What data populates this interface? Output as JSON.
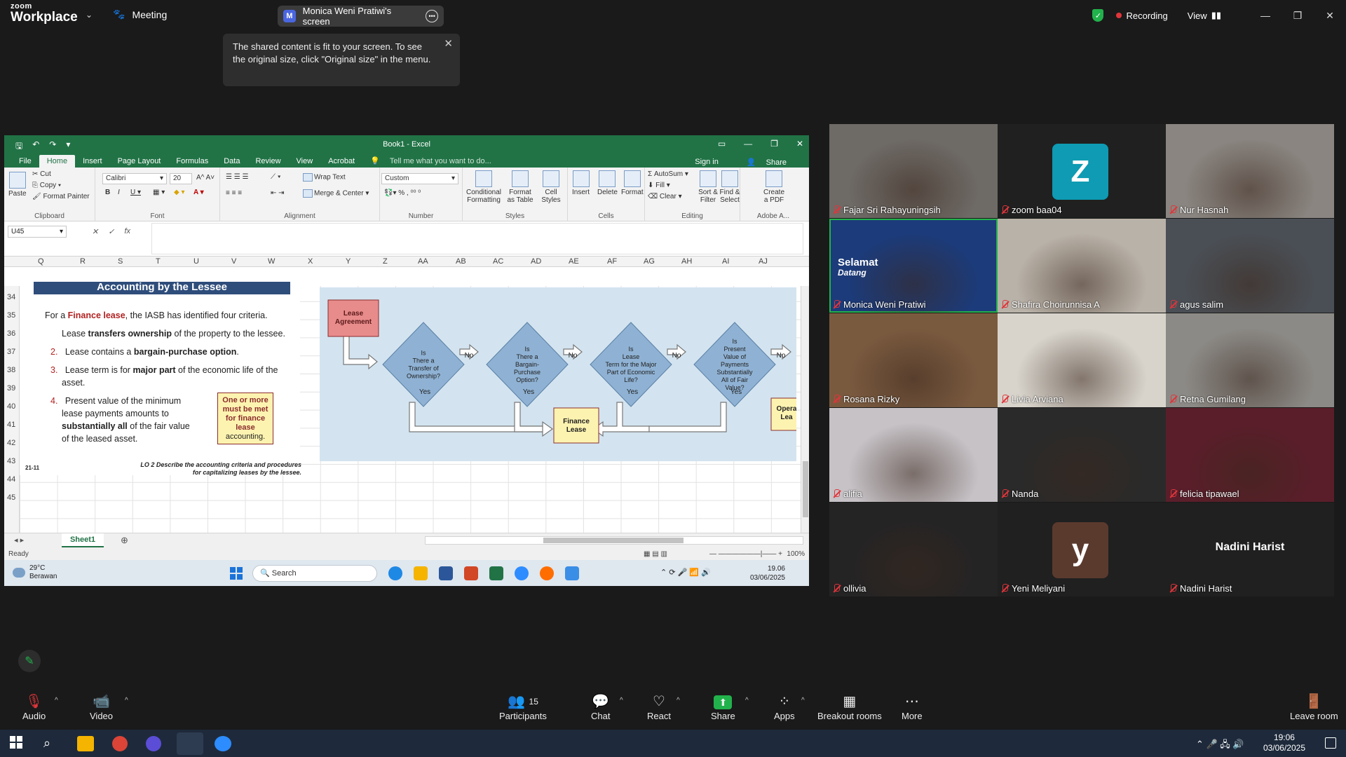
{
  "zoom": {
    "logo_line1": "zoom",
    "logo_line2": "Workplace",
    "meeting_label": "Meeting",
    "share_initial": "M",
    "share_label": "Monica Weni Pratiwi's screen",
    "recording_label": "Recording",
    "view_label": "View",
    "tooltip_text": "The shared content is fit to your screen. To see the original size, click \"Original size\" in the menu."
  },
  "excel": {
    "window_title": "Book1 - Excel",
    "tabs": [
      "File",
      "Home",
      "Insert",
      "Page Layout",
      "Formulas",
      "Data",
      "Review",
      "View",
      "Acrobat"
    ],
    "tell_me": "Tell me what you want to do...",
    "sign_in": "Sign in",
    "share": "Share",
    "clipboard": {
      "paste": "Paste",
      "cut": "Cut",
      "copy": "Copy",
      "format_painter": "Format Painter",
      "label": "Clipboard"
    },
    "font": {
      "name": "Calibri",
      "size": "20",
      "label": "Font"
    },
    "alignment": {
      "wrap": "Wrap Text",
      "merge": "Merge & Center",
      "label": "Alignment"
    },
    "number": {
      "format": "Custom",
      "label": "Number"
    },
    "styles": {
      "conditional": "Conditional Formatting",
      "format_table": "Format as Table",
      "cell_styles": "Cell Styles",
      "label": "Styles"
    },
    "cells": {
      "insert": "Insert",
      "delete": "Delete",
      "format": "Format",
      "label": "Cells"
    },
    "editing": {
      "autosum": "AutoSum",
      "fill": "Fill",
      "clear": "Clear",
      "sort": "Sort & Filter",
      "find": "Find & Select",
      "label": "Editing"
    },
    "acrobat": {
      "create": "Create a PDF",
      "label": "Adobe A..."
    },
    "name_box": "U45",
    "columns": [
      "Q",
      "R",
      "S",
      "T",
      "U",
      "V",
      "W",
      "X",
      "Y",
      "Z",
      "AA",
      "AB",
      "AC",
      "AD",
      "AE",
      "AF",
      "AG",
      "AH",
      "AI",
      "AJ"
    ],
    "rows": [
      "34",
      "35",
      "36",
      "37",
      "38",
      "39",
      "40",
      "41",
      "42",
      "43",
      "44",
      "45"
    ],
    "sheet_tab": "Sheet1",
    "status": "Ready",
    "zoom_pct": "100%"
  },
  "slide": {
    "title": "Accounting by the Lessee",
    "intro_pre": "For a ",
    "intro_red": "Finance lease",
    "intro_post": ", the IASB has identified four criteria.",
    "c1_pre": "Lease ",
    "c1_bold": "transfers ownership",
    "c1_post": " of the property to the lessee.",
    "c2_num": "2.",
    "c2_pre": "Lease contains a ",
    "c2_bold": "bargain-purchase option",
    "c2_post": ".",
    "c3_num": "3.",
    "c3_pre": "Lease term is for ",
    "c3_bold": "major part",
    "c3_post": " of the economic life of the",
    "c3_line2": "asset.",
    "c4_num": "4.",
    "c4_line1": "Present value of the minimum",
    "c4_line2": "lease payments amounts to",
    "c4_bold": "substantially all",
    "c4_post": " of the fair value",
    "c4_line4": "of the leased asset.",
    "box_l1": "One or more",
    "box_l2": "must be met",
    "box_l3": "for finance",
    "box_l4": "lease",
    "box_l5": "accounting.",
    "lo_line1": "LO 2  Describe the accounting criteria and procedures",
    "lo_line2": "for capitalizing leases by the lessee.",
    "page_no": "21-11",
    "flow": {
      "lease_agreement": "Lease Agreement",
      "q1": [
        "Is",
        "There a",
        "Transfer of",
        "Ownership?"
      ],
      "q2": [
        "Is",
        "There a",
        "Bargain-",
        "Purchase",
        "Option?"
      ],
      "q3": [
        "Is",
        "Lease",
        "Term for the Major",
        "Part of Economic",
        "Life?"
      ],
      "q4": [
        "Is",
        "Present",
        "Value of",
        "Payments",
        "Substantially",
        "All of Fair",
        "Value?"
      ],
      "no": "No",
      "yes": "Yes",
      "finance_lease": [
        "Finance",
        "Lease"
      ],
      "operating": [
        "Opera",
        "Lea"
      ]
    }
  },
  "win_inner": {
    "temp": "29°C",
    "weather": "Berawan",
    "search": "Search",
    "time": "19.06",
    "date": "03/06/2025"
  },
  "gallery": [
    {
      "name": "Fajar Sri Rahayuningsih",
      "type": "video",
      "bg": "#6e6a66"
    },
    {
      "name": "zoom baa04",
      "type": "avatar",
      "letter": "Z",
      "color": "#0e9bb3"
    },
    {
      "name": "Nur Hasnah",
      "type": "video",
      "bg": "#8a8580"
    },
    {
      "name": "Monica Weni Pratiwi",
      "type": "video",
      "bg": "#1c3b7a",
      "active": true,
      "overlay1": "Selamat",
      "overlay2": "Datang"
    },
    {
      "name": "Shafira Choirunnisa A",
      "type": "video",
      "bg": "#b9b2a8"
    },
    {
      "name": "agus salim",
      "type": "video",
      "bg": "#4a4f55"
    },
    {
      "name": "Rosana Rizky",
      "type": "video",
      "bg": "#7a5a3f"
    },
    {
      "name": "Livia Arviana",
      "type": "video",
      "bg": "#d8d4cc"
    },
    {
      "name": "Retna Gumilang",
      "type": "video",
      "bg": "#8c8a86"
    },
    {
      "name": "alifia",
      "type": "video",
      "bg": "#c6c2c6"
    },
    {
      "name": "Nanda",
      "type": "video",
      "bg": "#2a2a2a"
    },
    {
      "name": "felicia tipawael",
      "type": "video",
      "bg": "#5a1e2a"
    },
    {
      "name": "ollivia",
      "type": "video",
      "bg": "#242424"
    },
    {
      "name": "Yeni Meliyani",
      "type": "avatar",
      "letter": "y",
      "color": "#5b3a2e"
    },
    {
      "name": "Nadini Harist",
      "type": "text",
      "title": "Nadini Harist"
    }
  ],
  "toolbar": {
    "audio": "Audio",
    "video": "Video",
    "participants": "Participants",
    "participants_count": "15",
    "chat": "Chat",
    "react": "React",
    "share": "Share",
    "apps": "Apps",
    "breakout": "Breakout rooms",
    "more": "More",
    "leave": "Leave room"
  },
  "taskbar": {
    "time": "19:06",
    "date": "03/06/2025"
  }
}
